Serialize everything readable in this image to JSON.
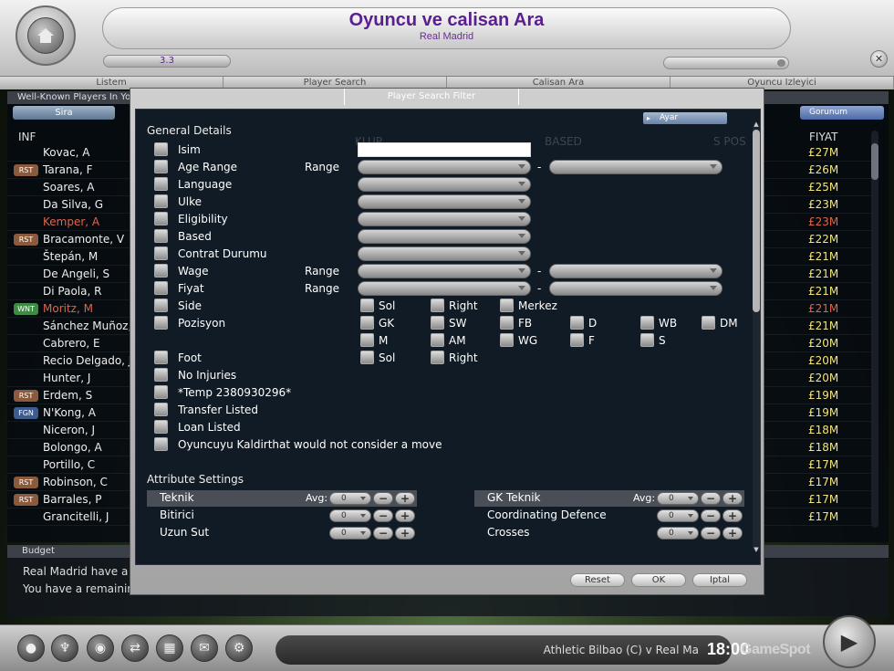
{
  "header": {
    "title": "Oyuncu ve calisan Ara",
    "subtitle": "Real Madrid",
    "score": "3.3",
    "close_label": "✕"
  },
  "tabs": [
    {
      "label": "Listem"
    },
    {
      "label": "Player Search"
    },
    {
      "label": "Calisan Ara"
    },
    {
      "label": "Oyuncu Izleyici"
    }
  ],
  "list": {
    "section_title": "Well-Known Players In Yo",
    "sort_label": "Sira",
    "view_label": "Gorunum",
    "col_inf": "INF",
    "col_fiyat": "FIYAT",
    "rows": [
      {
        "badge": "",
        "name": "Kovac, A",
        "price": "£27M"
      },
      {
        "badge": "RST",
        "name": "Tarana, F",
        "price": "£26M"
      },
      {
        "badge": "",
        "name": "Soares, A",
        "price": "£25M"
      },
      {
        "badge": "",
        "name": "Da Silva, G",
        "price": "£23M"
      },
      {
        "badge": "",
        "name": "Kemper, A",
        "price": "£23M",
        "red": true
      },
      {
        "badge": "RST",
        "name": "Bracamonte, V",
        "price": "£22M"
      },
      {
        "badge": "",
        "name": "Štepán, M",
        "price": "£21M"
      },
      {
        "badge": "",
        "name": "De Angeli, S",
        "price": "£21M"
      },
      {
        "badge": "",
        "name": "Di Paola, R",
        "price": "£21M"
      },
      {
        "badge": "WNT",
        "name": "Moritz, M",
        "price": "£21M",
        "red": true
      },
      {
        "badge": "",
        "name": "Sánchez Muñoz, E",
        "price": "£21M"
      },
      {
        "badge": "",
        "name": "Cabrero, E",
        "price": "£20M"
      },
      {
        "badge": "",
        "name": "Recio Delgado, J",
        "price": "£20M"
      },
      {
        "badge": "",
        "name": "Hunter, J",
        "price": "£20M"
      },
      {
        "badge": "RST",
        "name": "Erdem, S",
        "price": "£19M"
      },
      {
        "badge": "FGN",
        "name": "N'Kong, A",
        "price": "£19M"
      },
      {
        "badge": "",
        "name": "Niceron, J",
        "price": "£18M"
      },
      {
        "badge": "",
        "name": "Bolongo, A",
        "price": "£18M"
      },
      {
        "badge": "",
        "name": "Portillo, C",
        "price": "£17M"
      },
      {
        "badge": "RST",
        "name": "Robinson, C",
        "price": "£17M"
      },
      {
        "badge": "RST",
        "name": "Barrales, P",
        "price": "£17M"
      },
      {
        "badge": "",
        "name": "Grancitelli, J",
        "price": "£17M"
      }
    ]
  },
  "budget": {
    "title": "Budget",
    "line1": "Real Madrid have a re",
    "line2": "You have a remaining"
  },
  "bottom": {
    "news": "Athletic Bilbao (C) v Real Ma",
    "time": "18:00",
    "watermark": "GameSpot"
  },
  "dialog": {
    "title": "Player Search Filter",
    "settings_label": "Ayar",
    "general_title": "General Details",
    "range_label": "Range",
    "dash": "-",
    "fields": [
      {
        "label": "Isim"
      },
      {
        "label": "Age Range"
      },
      {
        "label": "Language"
      },
      {
        "label": "Ulke"
      },
      {
        "label": "Eligibility"
      },
      {
        "label": "Based"
      },
      {
        "label": "Contrat Durumu"
      },
      {
        "label": "Wage"
      },
      {
        "label": "Fiyat"
      },
      {
        "label": "Side"
      },
      {
        "label": "Pozisyon"
      },
      {
        "label": "Foot"
      },
      {
        "label": "No Injuries"
      },
      {
        "label": "*Temp 2380930296*"
      },
      {
        "label": "Transfer Listed"
      },
      {
        "label": "Loan Listed"
      },
      {
        "label": "Oyuncuyu Kaldirthat would not consider a move"
      }
    ],
    "side_options": [
      "Sol",
      "Right",
      "Merkez"
    ],
    "position_row1": [
      "GK",
      "SW",
      "FB",
      "D",
      "WB",
      "DM"
    ],
    "position_row2": [
      "M",
      "AM",
      "WG",
      "F",
      "S"
    ],
    "foot_options": [
      "Sol",
      "Right"
    ],
    "attr_title": "Attribute Settings",
    "avg_label": "Avg:",
    "attrs_left": [
      {
        "name": "Teknik",
        "value": "0"
      },
      {
        "name": "Bitirici",
        "value": "0"
      },
      {
        "name": "Uzun Sut",
        "value": "0"
      }
    ],
    "attrs_right": [
      {
        "name": "GK Teknik",
        "value": "0"
      },
      {
        "name": "Coordinating Defence",
        "value": "0"
      },
      {
        "name": "Crosses",
        "value": "0"
      }
    ],
    "reset_label": "Reset",
    "ok_label": "OK",
    "cancel_label": "Iptal"
  }
}
